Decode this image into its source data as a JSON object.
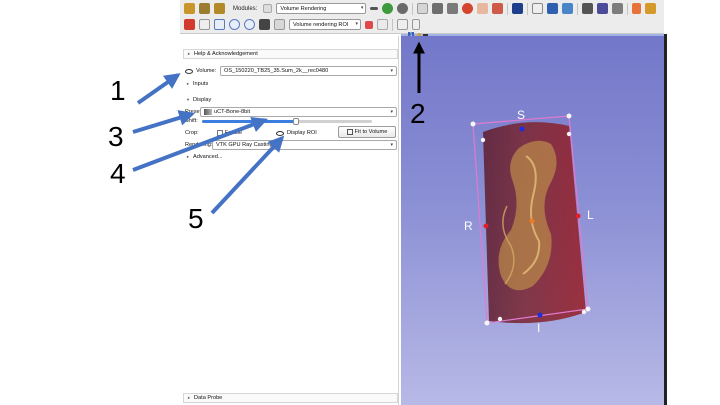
{
  "toolbar": {
    "modules_label": "Modules:",
    "module_selected": "Volume Rendering",
    "roi_selector": "Volume rendering ROI"
  },
  "panel": {
    "help_section": "Help & Acknowledgement",
    "volume_label": "Volume:",
    "volume_value": "OS_150220_TB25_35.Sum_2k__rec0480",
    "inputs_section": "Inputs",
    "display_section": "Display",
    "preset_label": "Preset:",
    "preset_value": "uCT-Bone-8bit",
    "shift_label": "Shift:",
    "shift_fraction": 0.55,
    "crop_label": "Crop:",
    "crop_enable": "Enable",
    "display_roi_label": "Display ROI",
    "fit_to_volume_label": "Fit to Volume",
    "rendering_label": "Rendering:",
    "rendering_value": "VTK GPU Ray Casting",
    "advanced_section": "Advanced...",
    "data_probe_section": "Data Probe"
  },
  "view3d": {
    "pin_label": "1",
    "orientation": {
      "superior": "S",
      "inferior": "I",
      "right": "R",
      "left": "L"
    }
  },
  "annotations": {
    "label_1": "1",
    "label_2": "2",
    "label_3": "3",
    "label_4": "4",
    "label_5": "5"
  },
  "colors": {
    "arrow_blue": "#4472c4",
    "view_top": "#7377c9",
    "view_bottom": "#b7b9e6",
    "roi_outline": "#e07ad0",
    "bone_volume": "#b8874a"
  }
}
